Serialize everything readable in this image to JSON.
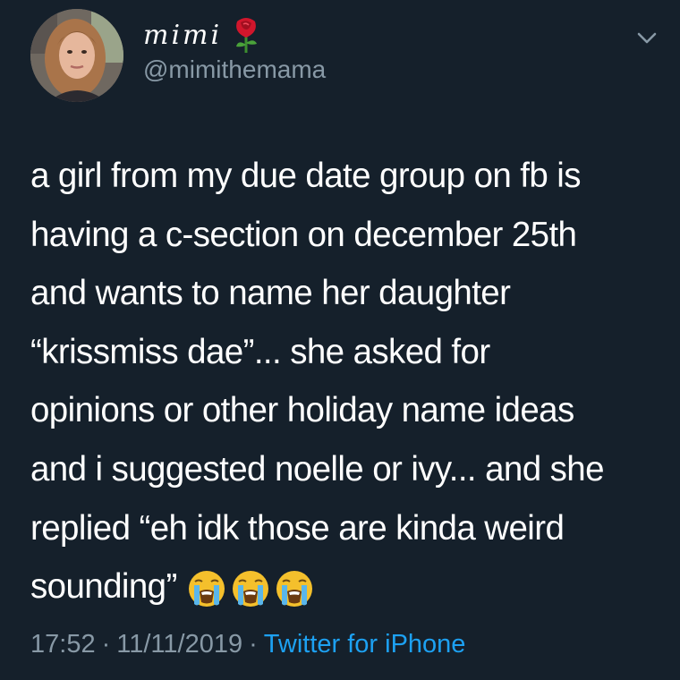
{
  "author": {
    "display_name": "mimi",
    "handle": "@mimithemama",
    "avatar_icon": "profile-photo",
    "name_emoji": "rose-icon"
  },
  "tweet": {
    "lines": [
      "a girl from my due date group on fb is",
      "having a c-section on december 25th",
      "and wants to name her daughter",
      "“krissmiss dae”... she asked for",
      "opinions or other holiday name ideas",
      "and i suggested noelle or ivy... and she",
      "replied “eh idk those are kinda weird",
      "sounding”"
    ],
    "trailing_emojis": [
      "loudly-crying-face-icon",
      "loudly-crying-face-icon",
      "loudly-crying-face-icon"
    ]
  },
  "meta": {
    "time": "17:52",
    "date": "11/11/2019",
    "separator": "·",
    "source": "Twitter for iPhone"
  },
  "colors": {
    "background": "#15202b",
    "text": "#ffffff",
    "muted": "#8899a6",
    "link": "#1da1f2"
  }
}
